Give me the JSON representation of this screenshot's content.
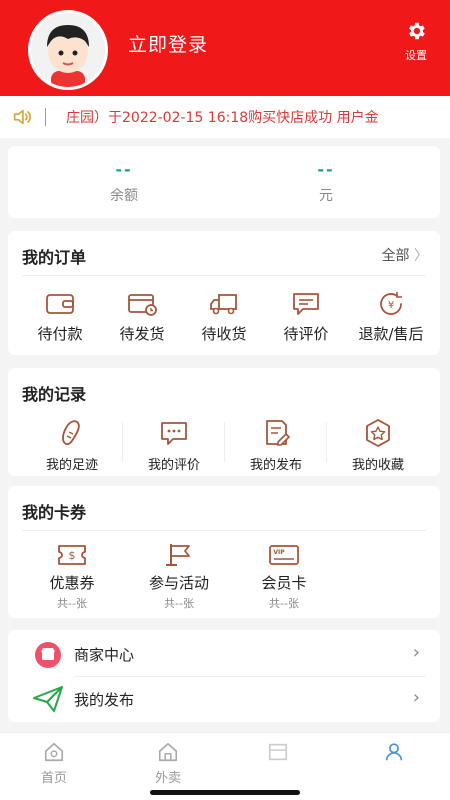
{
  "header": {
    "login_label": "立即登录",
    "settings_label": "设置",
    "settings_icon": "gear-icon"
  },
  "notice": {
    "text": "庄园）于2022-02-15 16:18购买快店成功   用户金"
  },
  "balance": {
    "balance_value": "--",
    "balance_label": "余额",
    "unit_value": "--",
    "unit_label": "元"
  },
  "orders": {
    "title": "我的订单",
    "more_label": "全部",
    "items": [
      {
        "label": "待付款",
        "icon": "wallet-icon"
      },
      {
        "label": "待发货",
        "icon": "card-clock-icon"
      },
      {
        "label": "待收货",
        "icon": "truck-icon"
      },
      {
        "label": "待评价",
        "icon": "comment-icon"
      },
      {
        "label": "退款/售后",
        "icon": "refund-icon"
      }
    ]
  },
  "records": {
    "title": "我的记录",
    "items": [
      {
        "label": "我的足迹",
        "icon": "footprint-icon"
      },
      {
        "label": "我的评价",
        "icon": "chat-bubble-icon"
      },
      {
        "label": "我的发布",
        "icon": "edit-note-icon"
      },
      {
        "label": "我的收藏",
        "icon": "star-badge-icon"
      }
    ]
  },
  "coupons": {
    "title": "我的卡券",
    "items": [
      {
        "label": "优惠券",
        "count": "共--张",
        "icon": "coupon-icon"
      },
      {
        "label": "参与活动",
        "count": "共--张",
        "icon": "flag-icon"
      },
      {
        "label": "会员卡",
        "count": "共--张",
        "icon": "vip-card-icon"
      }
    ]
  },
  "list": {
    "items": [
      {
        "label": "商家中心",
        "icon": "shop-icon"
      },
      {
        "label": "我的发布",
        "icon": "send-icon"
      }
    ]
  },
  "tabbar": {
    "items": [
      {
        "label": "首页",
        "icon": "home-icon"
      },
      {
        "label": "外卖",
        "icon": "takeout-icon"
      }
    ]
  },
  "colors": {
    "brand_red": "#f01818",
    "accent_brown": "#a5553a",
    "accent_green": "#1aa384"
  }
}
